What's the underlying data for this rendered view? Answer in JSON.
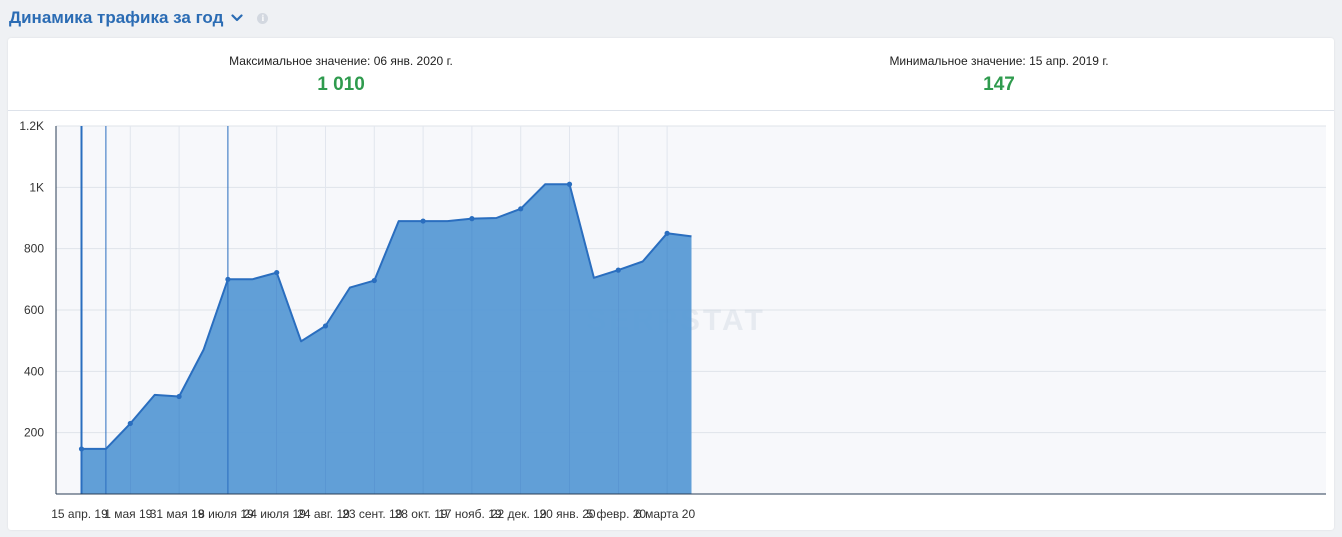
{
  "header": {
    "title": "Динамика трафика за год",
    "dropdown_icon": "chevron-down-icon",
    "info_icon": "info-icon"
  },
  "stats": {
    "max_label": "Максимальное значение: 06 янв. 2020 г.",
    "max_value": "1 010",
    "min_label": "Минимальное значение: 15 апр. 2019 г.",
    "min_value": "147"
  },
  "watermark": "SERPSTAT",
  "colors": {
    "accent": "#2b6cb4",
    "area_fill": "#5b9bd5",
    "line": "#2a6ebf",
    "value_green": "#2f9b4e"
  },
  "chart_data": {
    "type": "area",
    "title": "",
    "xlabel": "",
    "ylabel": "",
    "ylim": [
      0,
      1200
    ],
    "yticks": [
      {
        "value": 200,
        "label": "200"
      },
      {
        "value": 400,
        "label": "400"
      },
      {
        "value": 600,
        "label": "600"
      },
      {
        "value": 800,
        "label": "800"
      },
      {
        "value": 1000,
        "label": "1K"
      },
      {
        "value": 1200,
        "label": "1.2K"
      }
    ],
    "xtick_labels": [
      {
        "i": 0,
        "label": "15 апр. 19"
      },
      {
        "i": 2,
        "label": "1 мая 19"
      },
      {
        "i": 4,
        "label": "31 мая 19"
      },
      {
        "i": 6,
        "label": "8 июля 19"
      },
      {
        "i": 8,
        "label": "24 июля 19"
      },
      {
        "i": 10,
        "label": "24 авг. 19"
      },
      {
        "i": 12,
        "label": "23 сент. 19"
      },
      {
        "i": 14,
        "label": "28 окт. 19"
      },
      {
        "i": 16,
        "label": "17 нояб. 19"
      },
      {
        "i": 18,
        "label": "22 дек. 19"
      },
      {
        "i": 20,
        "label": "20 янв. 20"
      },
      {
        "i": 22,
        "label": "5 февр. 20"
      },
      {
        "i": 24,
        "label": "6 марта 20"
      }
    ],
    "highlighted_indices": [
      0,
      1,
      6
    ],
    "series": [
      {
        "values": [
          147,
          147,
          230,
          323,
          318,
          470,
          700,
          700,
          722,
          498,
          548,
          673,
          696,
          890,
          890,
          890,
          898,
          900,
          930,
          1010,
          1010,
          705,
          730,
          758,
          850,
          840
        ],
        "markers": [
          true,
          false,
          true,
          false,
          true,
          false,
          true,
          false,
          true,
          false,
          true,
          false,
          true,
          false,
          true,
          false,
          true,
          false,
          true,
          false,
          true,
          false,
          true,
          false,
          true,
          false
        ]
      }
    ],
    "grid": true
  }
}
